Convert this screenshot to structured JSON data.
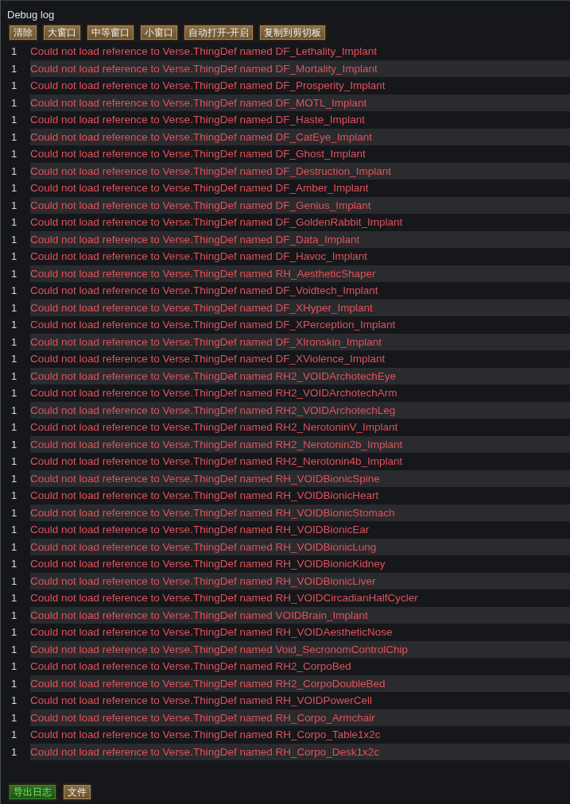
{
  "window": {
    "title": "Debug log"
  },
  "toolbar": [
    {
      "label": "清除"
    },
    {
      "label": "大窗口"
    },
    {
      "label": "中等窗口"
    },
    {
      "label": "小窗口"
    },
    {
      "label": "自动打开-开启"
    },
    {
      "label": "复制到剪切板"
    }
  ],
  "log": [
    {
      "count": "1",
      "message": "Could not load reference to Verse.ThingDef named DF_Lethality_Implant"
    },
    {
      "count": "1",
      "message": "Could not load reference to Verse.ThingDef named DF_Mortality_Implant"
    },
    {
      "count": "1",
      "message": "Could not load reference to Verse.ThingDef named DF_Prosperity_Implant"
    },
    {
      "count": "1",
      "message": "Could not load reference to Verse.ThingDef named DF_MOTL_Implant"
    },
    {
      "count": "1",
      "message": "Could not load reference to Verse.ThingDef named DF_Haste_Implant"
    },
    {
      "count": "1",
      "message": "Could not load reference to Verse.ThingDef named DF_CatEye_Implant"
    },
    {
      "count": "1",
      "message": "Could not load reference to Verse.ThingDef named DF_Ghost_Implant"
    },
    {
      "count": "1",
      "message": "Could not load reference to Verse.ThingDef named DF_Destruction_Implant"
    },
    {
      "count": "1",
      "message": "Could not load reference to Verse.ThingDef named DF_Amber_Implant"
    },
    {
      "count": "1",
      "message": "Could not load reference to Verse.ThingDef named DF_Genius_Implant"
    },
    {
      "count": "1",
      "message": "Could not load reference to Verse.ThingDef named DF_GoldenRabbit_Implant"
    },
    {
      "count": "1",
      "message": "Could not load reference to Verse.ThingDef named DF_Data_Implant"
    },
    {
      "count": "1",
      "message": "Could not load reference to Verse.ThingDef named DF_Havoc_Implant"
    },
    {
      "count": "1",
      "message": "Could not load reference to Verse.ThingDef named RH_AestheticShaper"
    },
    {
      "count": "1",
      "message": "Could not load reference to Verse.ThingDef named DF_Voidtech_Implant"
    },
    {
      "count": "1",
      "message": "Could not load reference to Verse.ThingDef named DF_XHyper_Implant"
    },
    {
      "count": "1",
      "message": "Could not load reference to Verse.ThingDef named DF_XPerception_Implant"
    },
    {
      "count": "1",
      "message": "Could not load reference to Verse.ThingDef named DF_XIronskin_Implant"
    },
    {
      "count": "1",
      "message": "Could not load reference to Verse.ThingDef named DF_XViolence_Implant"
    },
    {
      "count": "1",
      "message": "Could not load reference to Verse.ThingDef named RH2_VOIDArchotechEye"
    },
    {
      "count": "1",
      "message": "Could not load reference to Verse.ThingDef named RH2_VOIDArchotechArm"
    },
    {
      "count": "1",
      "message": "Could not load reference to Verse.ThingDef named RH2_VOIDArchotechLeg"
    },
    {
      "count": "1",
      "message": "Could not load reference to Verse.ThingDef named RH2_NerotoninV_Implant"
    },
    {
      "count": "1",
      "message": "Could not load reference to Verse.ThingDef named RH2_Nerotonin2b_Implant"
    },
    {
      "count": "1",
      "message": "Could not load reference to Verse.ThingDef named RH2_Nerotonin4b_Implant"
    },
    {
      "count": "1",
      "message": "Could not load reference to Verse.ThingDef named RH_VOIDBionicSpine"
    },
    {
      "count": "1",
      "message": "Could not load reference to Verse.ThingDef named RH_VOIDBionicHeart"
    },
    {
      "count": "1",
      "message": "Could not load reference to Verse.ThingDef named RH_VOIDBionicStomach"
    },
    {
      "count": "1",
      "message": "Could not load reference to Verse.ThingDef named RH_VOIDBionicEar"
    },
    {
      "count": "1",
      "message": "Could not load reference to Verse.ThingDef named RH_VOIDBionicLung"
    },
    {
      "count": "1",
      "message": "Could not load reference to Verse.ThingDef named RH_VOIDBionicKidney"
    },
    {
      "count": "1",
      "message": "Could not load reference to Verse.ThingDef named RH_VOIDBionicLiver"
    },
    {
      "count": "1",
      "message": "Could not load reference to Verse.ThingDef named RH_VOIDCircadianHalfCycler"
    },
    {
      "count": "1",
      "message": "Could not load reference to Verse.ThingDef named VOIDBrain_Implant"
    },
    {
      "count": "1",
      "message": "Could not load reference to Verse.ThingDef named RH_VOIDAestheticNose"
    },
    {
      "count": "1",
      "message": "Could not load reference to Verse.ThingDef named Void_SecronomControlChip"
    },
    {
      "count": "1",
      "message": "Could not load reference to Verse.ThingDef named RH2_CorpoBed"
    },
    {
      "count": "1",
      "message": "Could not load reference to Verse.ThingDef named RH2_CorpoDoubleBed"
    },
    {
      "count": "1",
      "message": "Could not load reference to Verse.ThingDef named RH_VOIDPowerCell"
    },
    {
      "count": "1",
      "message": "Could not load reference to Verse.ThingDef named RH_Corpo_Armchair"
    },
    {
      "count": "1",
      "message": "Could not load reference to Verse.ThingDef named RH_Corpo_Table1x2c"
    },
    {
      "count": "1",
      "message": "Could not load reference to Verse.ThingDef named RH_Corpo_Desk1x2c"
    }
  ],
  "bottom_bar": [
    {
      "label": "导出日志",
      "kind": "accent"
    },
    {
      "label": "文件",
      "kind": "normal"
    }
  ]
}
